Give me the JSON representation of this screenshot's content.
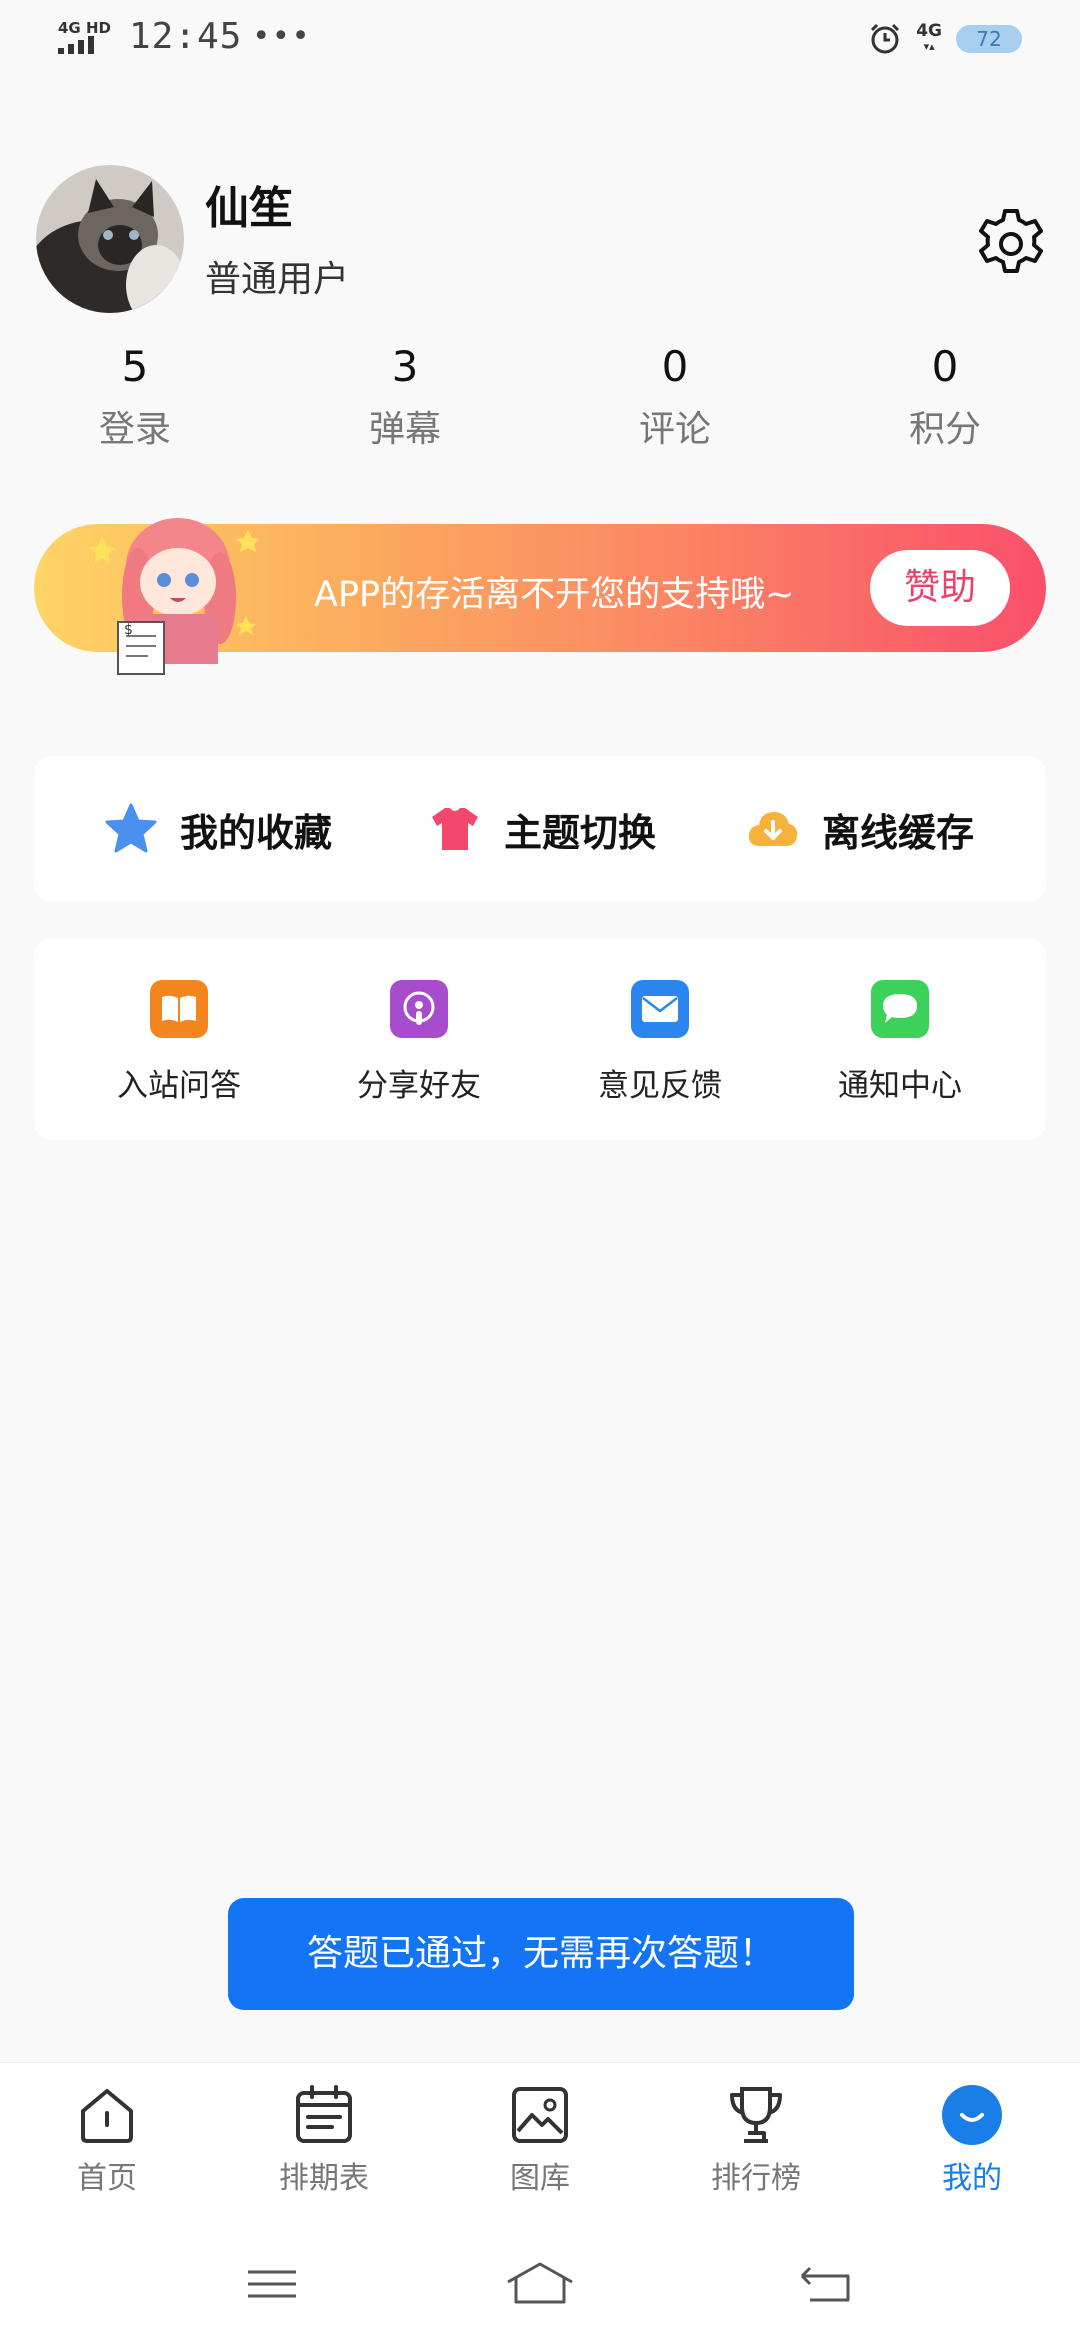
{
  "status_bar": {
    "signal": "4G HD",
    "time": "12:45",
    "more": "•••",
    "network": "4G",
    "battery": "72"
  },
  "profile": {
    "name": "仙笙",
    "user_type": "普通用户"
  },
  "stats": [
    {
      "value": "5",
      "label": "登录"
    },
    {
      "value": "3",
      "label": "弹幕"
    },
    {
      "value": "0",
      "label": "评论"
    },
    {
      "value": "0",
      "label": "积分"
    }
  ],
  "banner": {
    "text": "APP的存活离不开您的支持哦~",
    "button": "赞助"
  },
  "quick_actions": [
    {
      "label": "我的收藏",
      "icon": "star-icon"
    },
    {
      "label": "主题切换",
      "icon": "shirt-icon"
    },
    {
      "label": "离线缓存",
      "icon": "cloud-download-icon"
    }
  ],
  "services": [
    {
      "label": "入站问答",
      "icon": "book-icon",
      "color": "#f5861f"
    },
    {
      "label": "分享好友",
      "icon": "podcast-icon",
      "color": "#a64ccc"
    },
    {
      "label": "意见反馈",
      "icon": "mail-icon",
      "color": "#2b86ef"
    },
    {
      "label": "通知中心",
      "icon": "message-icon",
      "color": "#3cd15a"
    }
  ],
  "toast": "答题已通过，无需再次答题！",
  "tabs": [
    {
      "label": "首页",
      "icon": "home-icon"
    },
    {
      "label": "排期表",
      "icon": "calendar-icon"
    },
    {
      "label": "图库",
      "icon": "gallery-icon"
    },
    {
      "label": "排行榜",
      "icon": "trophy-icon"
    },
    {
      "label": "我的",
      "icon": "profile-icon",
      "active": true
    }
  ],
  "colors": {
    "accent": "#1a7ee9",
    "toast_bg": "#1375f6",
    "sponsor_text": "#e8436a"
  }
}
